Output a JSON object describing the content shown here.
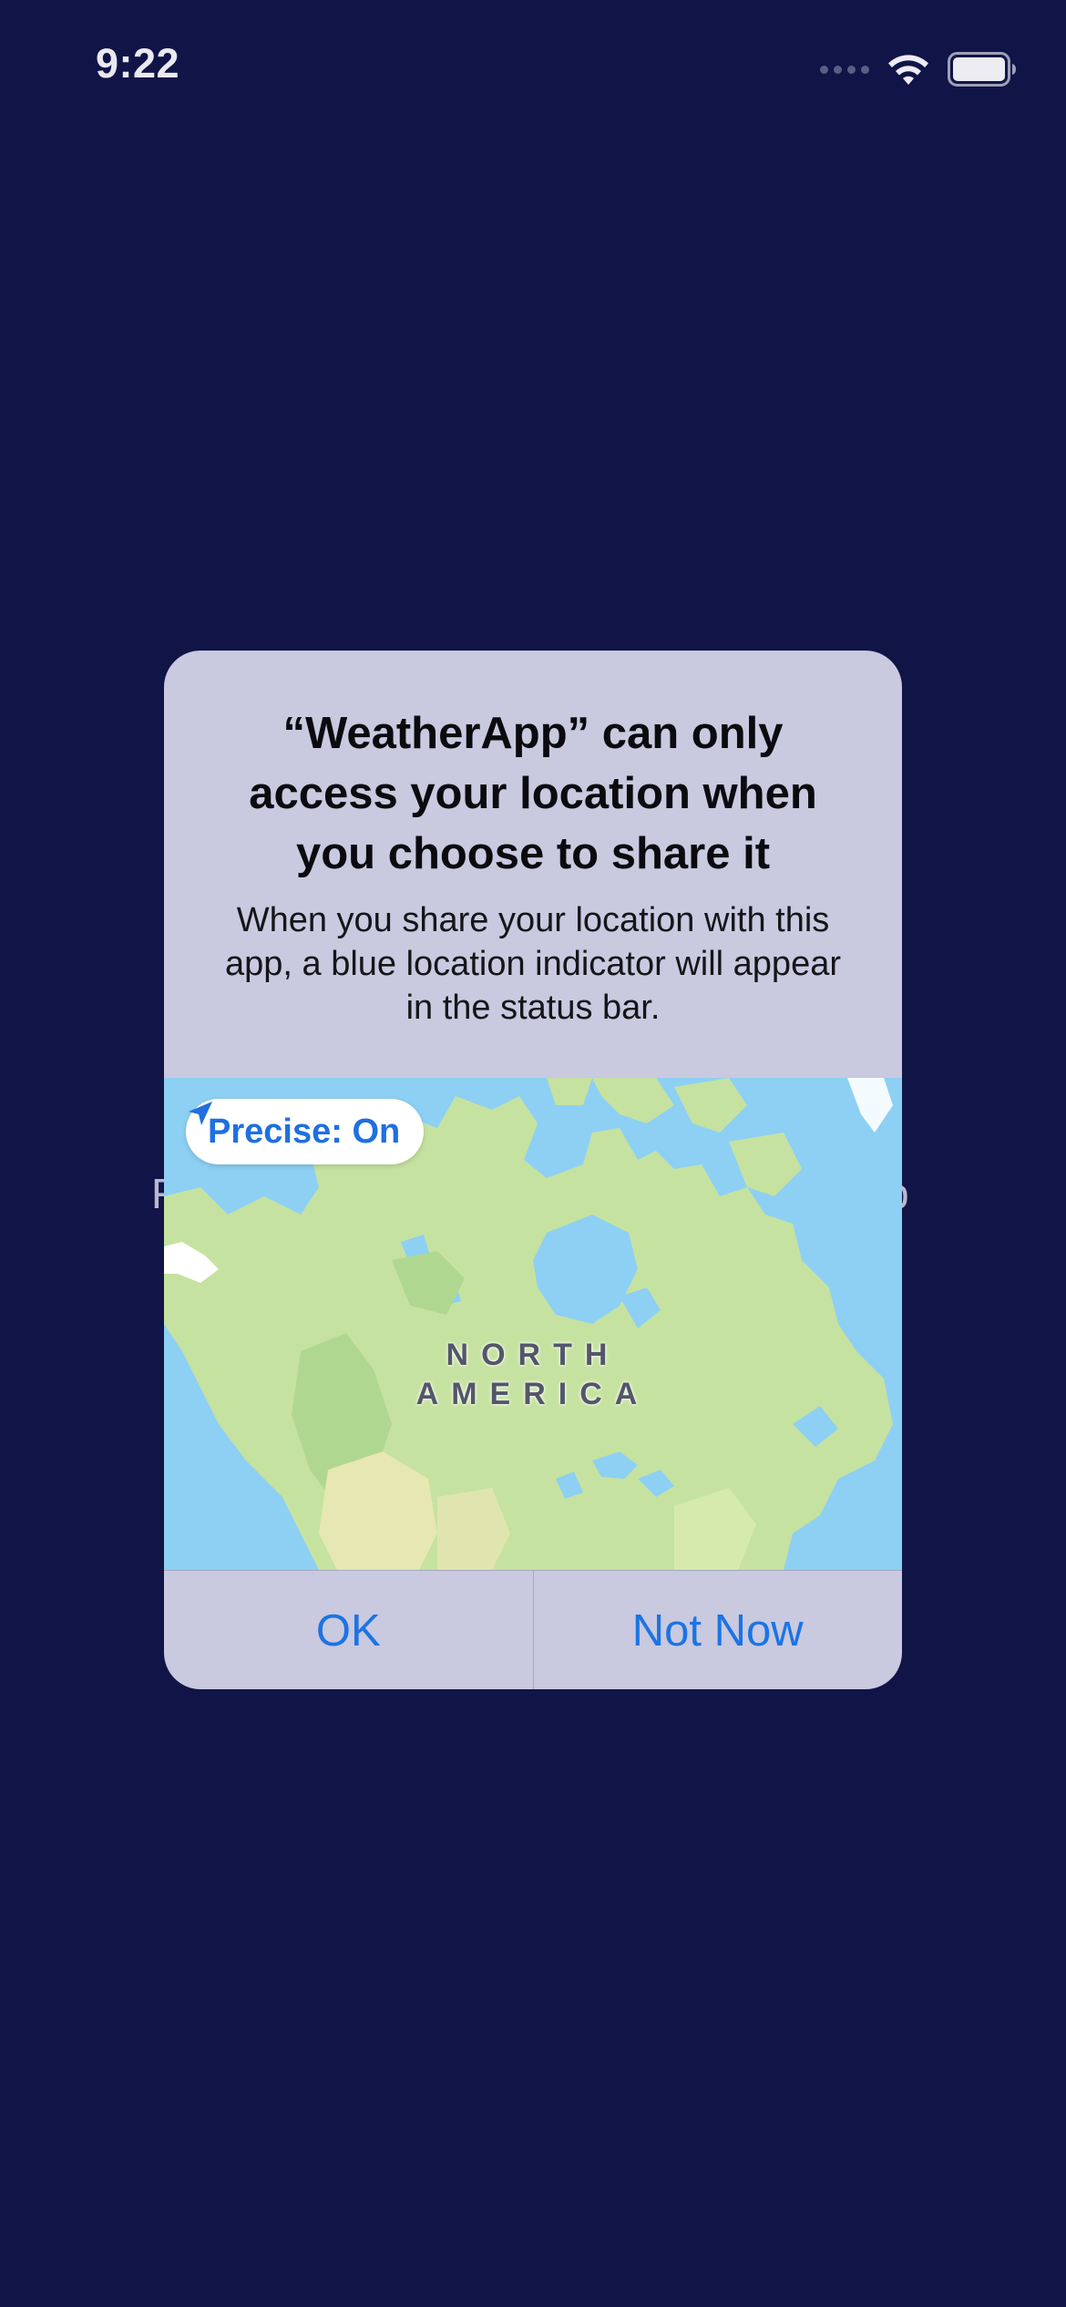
{
  "status_bar": {
    "time": "9:22",
    "icons": [
      "cellular-signal-icon",
      "wifi-icon",
      "battery-icon"
    ]
  },
  "background": {
    "left_fragment": "F",
    "right_fragment": "p"
  },
  "alert": {
    "title": "“WeatherApp” can only access your location when you choose to share it",
    "message": "When you share your location with this app, a blue location indicator will appear in the status bar.",
    "map": {
      "precise_toggle_label": "Precise: On",
      "precise_icon": "location-arrow-icon",
      "region_label_line1": "NORTH",
      "region_label_line2": "AMERICA"
    },
    "buttons": {
      "ok": "OK",
      "not_now": "Not Now"
    }
  },
  "colors": {
    "background": "#111447",
    "alert_bg": "#c9c9df",
    "accent": "#1b74e4",
    "water": "#8dd0f4",
    "land": "#c6e2a0"
  }
}
